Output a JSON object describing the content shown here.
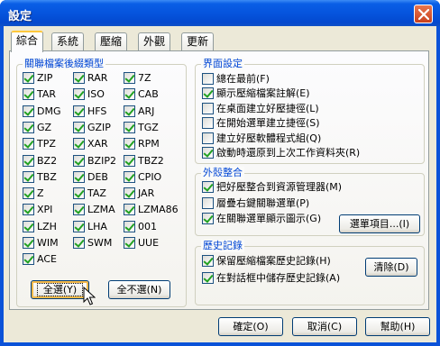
{
  "window": {
    "title": "設定"
  },
  "tabs": [
    "綜合",
    "系統",
    "壓縮",
    "外觀",
    "更新"
  ],
  "assoc": {
    "title": "關聯檔案後綴類型",
    "items": [
      {
        "label": "ZIP",
        "checked": true
      },
      {
        "label": "RAR",
        "checked": true
      },
      {
        "label": "7Z",
        "checked": true
      },
      {
        "label": "TAR",
        "checked": true
      },
      {
        "label": "ISO",
        "checked": true
      },
      {
        "label": "CAB",
        "checked": true
      },
      {
        "label": "DMG",
        "checked": true
      },
      {
        "label": "HFS",
        "checked": true
      },
      {
        "label": "ARJ",
        "checked": true
      },
      {
        "label": "GZ",
        "checked": true
      },
      {
        "label": "GZIP",
        "checked": true
      },
      {
        "label": "TGZ",
        "checked": true
      },
      {
        "label": "TPZ",
        "checked": true
      },
      {
        "label": "XAR",
        "checked": true
      },
      {
        "label": "RPM",
        "checked": true
      },
      {
        "label": "BZ2",
        "checked": true
      },
      {
        "label": "BZIP2",
        "checked": true
      },
      {
        "label": "TBZ2",
        "checked": true
      },
      {
        "label": "TBZ",
        "checked": true
      },
      {
        "label": "DEB",
        "checked": true
      },
      {
        "label": "CPIO",
        "checked": true
      },
      {
        "label": "Z",
        "checked": true
      },
      {
        "label": "TAZ",
        "checked": true
      },
      {
        "label": "JAR",
        "checked": true
      },
      {
        "label": "XPI",
        "checked": true
      },
      {
        "label": "LZMA",
        "checked": true
      },
      {
        "label": "LZMA86",
        "checked": true
      },
      {
        "label": "LZH",
        "checked": true
      },
      {
        "label": "LHA",
        "checked": true
      },
      {
        "label": "001",
        "checked": true
      },
      {
        "label": "WIM",
        "checked": true
      },
      {
        "label": "SWM",
        "checked": true
      },
      {
        "label": "UUE",
        "checked": true
      },
      {
        "label": "ACE",
        "checked": true
      }
    ],
    "select_all": "全選(Y)",
    "select_none": "全不選(N)"
  },
  "interface": {
    "title": "界面設定",
    "items": [
      {
        "label": "總在最前(F)",
        "checked": false
      },
      {
        "label": "顯示壓縮檔案註解(E)",
        "checked": true
      },
      {
        "label": "在桌面建立好壓捷徑(L)",
        "checked": false
      },
      {
        "label": "在開始選單建立捷徑(S)",
        "checked": false
      },
      {
        "label": "建立好壓軟體程式組(Q)",
        "checked": false
      },
      {
        "label": "啟動時還原到上次工作資料夾(R)",
        "checked": true
      }
    ]
  },
  "shell": {
    "title": "外殼整合",
    "items": [
      {
        "label": "把好壓整合到資源管理器(M)",
        "checked": true
      },
      {
        "label": "層疊右鍵關聯選單(P)",
        "checked": false
      },
      {
        "label": "在關聯選單顯示圖示(G)",
        "checked": true
      }
    ],
    "menu_items_button": "選單項目...(I)"
  },
  "history": {
    "title": "歷史記錄",
    "items": [
      {
        "label": "保留壓縮檔案歷史記錄(H)",
        "checked": true
      },
      {
        "label": "在對話框中儲存歷史記錄(A)",
        "checked": true
      }
    ],
    "clear_button": "清除(D)"
  },
  "footer": {
    "ok": "確定(O)",
    "cancel": "取消(C)",
    "help": "幫助(H)"
  }
}
